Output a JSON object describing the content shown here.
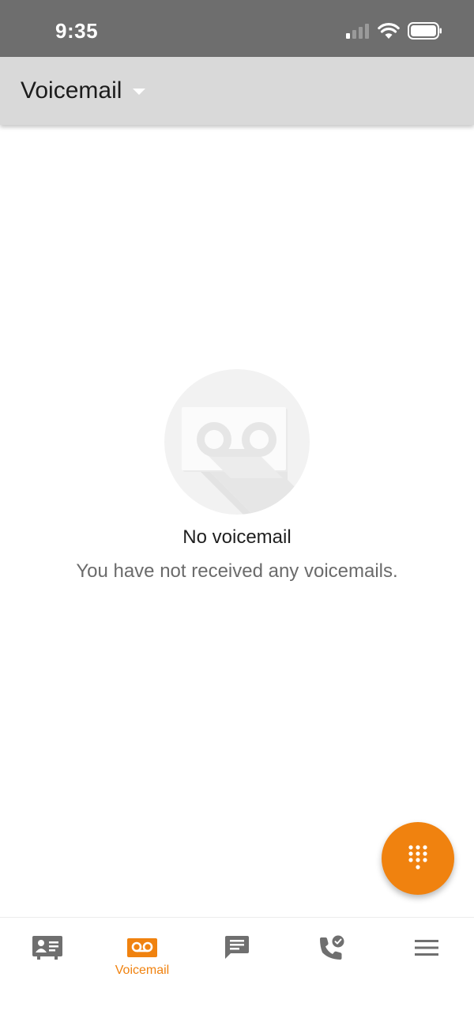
{
  "status_bar": {
    "time": "9:35",
    "icons": [
      "cellular-signal-icon",
      "wifi-icon",
      "battery-icon"
    ]
  },
  "app_bar": {
    "title": "Voicemail",
    "dropdown_icon": "caret-down-icon"
  },
  "empty_state": {
    "icon": "voicemail-tape-icon",
    "title": "No voicemail",
    "message": "You have not received any voicemails."
  },
  "fab": {
    "icon": "dialpad-icon"
  },
  "bottom_nav": {
    "items": [
      {
        "icon": "contacts-card-icon",
        "label": "",
        "active": false
      },
      {
        "icon": "voicemail-icon",
        "label": "Voicemail",
        "active": true
      },
      {
        "icon": "chat-bubble-icon",
        "label": "",
        "active": false
      },
      {
        "icon": "call-history-icon",
        "label": "",
        "active": false
      },
      {
        "icon": "menu-icon",
        "label": "",
        "active": false
      }
    ]
  },
  "colors": {
    "accent": "#f0820f",
    "status_bar_bg": "#6e6e6e",
    "app_bar_bg": "#d9d9d9",
    "inactive_icon": "#6f6f6f",
    "illustration_bg": "#f2f2f2"
  }
}
